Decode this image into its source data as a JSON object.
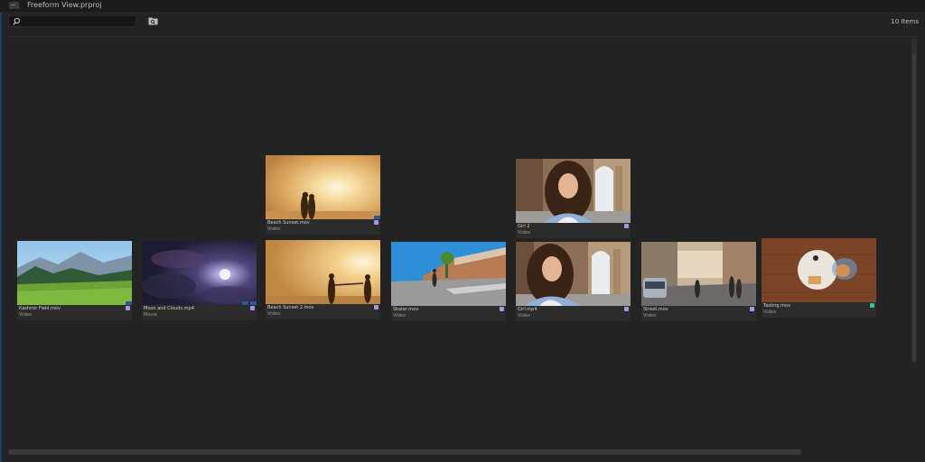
{
  "window": {
    "title": "Freeform View.prproj"
  },
  "toolbar": {
    "search_value": "",
    "items_count": "10 Items"
  },
  "colors": {
    "accent": "#1f3f67",
    "label_lavender": "#a694e6",
    "label_green": "#27c69a"
  },
  "clips": [
    {
      "name": "Beach Sunset.mov",
      "type": "Video",
      "label_color": "#a694e6",
      "thumb": "sunset-couple"
    },
    {
      "name": "Girl 2",
      "type": "Video",
      "label_color": "#a694e6",
      "thumb": "girl"
    },
    {
      "name": "Kashmir Field.mov",
      "type": "Video",
      "label_color": "#a694e6",
      "thumb": "mountains"
    },
    {
      "name": "Moon and Clouds.mp4",
      "type": "Movie",
      "label_color": "#a694e6",
      "thumb": "moon"
    },
    {
      "name": "Beach Sunset 2.mov",
      "type": "Video",
      "label_color": "#a694e6",
      "thumb": "sunset-hands"
    },
    {
      "name": "Skater.mov",
      "type": "Video",
      "label_color": "#a694e6",
      "thumb": "street"
    },
    {
      "name": "Girl.mp4",
      "type": "Video",
      "label_color": "#a694e6",
      "thumb": "girl"
    },
    {
      "name": "Street.mov",
      "type": "Video",
      "label_color": "#a694e6",
      "thumb": "city"
    },
    {
      "name": "Tasting.mov",
      "type": "Video",
      "label_color": "#27c69a",
      "thumb": "table"
    }
  ]
}
